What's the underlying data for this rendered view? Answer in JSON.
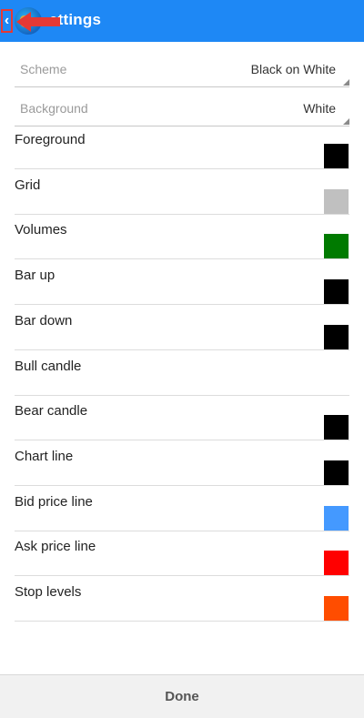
{
  "header": {
    "title": "ettings",
    "back_icon": "chevron-left-icon",
    "app_icon": "app-logo-icon",
    "annotation_arrow_color": "#e53935"
  },
  "selects": [
    {
      "label": "Scheme",
      "value": "Black on White"
    },
    {
      "label": "Background",
      "value": "White"
    }
  ],
  "colors": [
    {
      "label": "Foreground",
      "color": "#000000"
    },
    {
      "label": "Grid",
      "color": "#c0c0c0"
    },
    {
      "label": "Volumes",
      "color": "#007a00"
    },
    {
      "label": "Bar up",
      "color": "#000000"
    },
    {
      "label": "Bar down",
      "color": "#000000"
    },
    {
      "label": "Bull candle",
      "color": "#ffffff"
    },
    {
      "label": "Bear candle",
      "color": "#000000"
    },
    {
      "label": "Chart line",
      "color": "#000000"
    },
    {
      "label": "Bid price line",
      "color": "#4499ff"
    },
    {
      "label": "Ask price line",
      "color": "#ff0000"
    },
    {
      "label": "Stop levels",
      "color": "#ff4d00"
    }
  ],
  "footer": {
    "done_label": "Done"
  },
  "theme": {
    "appbar": "#1e88f5"
  }
}
